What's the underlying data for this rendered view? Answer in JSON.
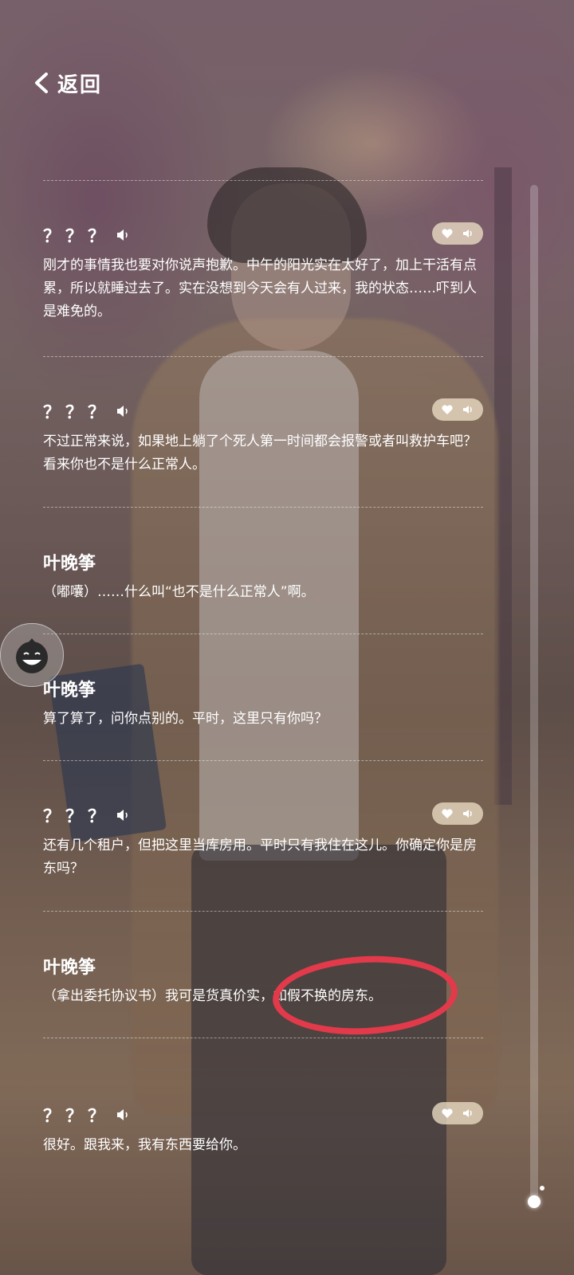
{
  "header": {
    "back_label": "返回"
  },
  "log": [
    {
      "speaker": "？？？",
      "text": "刚才的事情我也要对你说声抱歉。中午的阳光实在太好了，加上干活有点累，所以就睡过去了。实在没想到今天会有人过来，我的状态……吓到人是难免的。",
      "has_voice": true
    },
    {
      "speaker": "？？？",
      "text": "不过正常来说，如果地上躺了个死人第一时间都会报警或者叫救护车吧？看来你也不是什么正常人。",
      "has_voice": true
    },
    {
      "speaker": "叶晚筝",
      "text": "（嘟囔）……什么叫“也不是什么正常人”啊。",
      "has_voice": false
    },
    {
      "speaker": "叶晚筝",
      "text": "算了算了，问你点别的。平时，这里只有你吗？",
      "has_voice": false
    },
    {
      "speaker": "？？？",
      "text": "还有几个租户，但把这里当库房用。平时只有我住在这儿。你确定你是房东吗？",
      "has_voice": true
    },
    {
      "speaker": "叶晚筝",
      "text": "（拿出委托协议书）我可是货真价实，如假不换的房东。",
      "has_voice": false
    },
    {
      "speaker": "？？？",
      "text": "很好。跟我来，我有东西要给你。",
      "has_voice": true
    }
  ],
  "icons": {
    "back": "chevron-left-icon",
    "voice": "speaker-icon",
    "favorite": "heart-icon",
    "replay": "sound-icon",
    "assistant": "avatar-icon"
  },
  "colors": {
    "annotation": "#e23a4a",
    "pill": "#f0e1c8"
  }
}
